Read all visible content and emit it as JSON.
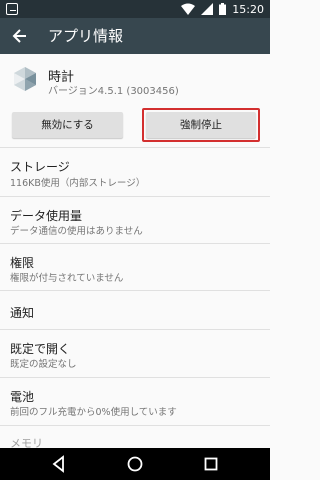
{
  "status_bar": {
    "time": "15:20"
  },
  "app_bar": {
    "title": "アプリ情報"
  },
  "app": {
    "name": "時計",
    "version": "バージョン4.5.1 (3003456)"
  },
  "buttons": {
    "disable": "無効にする",
    "force_stop": "強制停止"
  },
  "items": [
    {
      "title": "ストレージ",
      "subtitle": "116KB使用（内部ストレージ）"
    },
    {
      "title": "データ使用量",
      "subtitle": "データ通信の使用はありません"
    },
    {
      "title": "権限",
      "subtitle": "権限が付与されていません"
    },
    {
      "title": "通知",
      "subtitle": ""
    },
    {
      "title": "既定で開く",
      "subtitle": "既定の設定なし"
    },
    {
      "title": "電池",
      "subtitle": "前回のフル充電から0%使用しています"
    },
    {
      "title": "メモリ",
      "subtitle": ""
    }
  ],
  "colors": {
    "status_bar": "#263238",
    "app_bar": "#37474f",
    "highlight": "#d32f2f"
  }
}
